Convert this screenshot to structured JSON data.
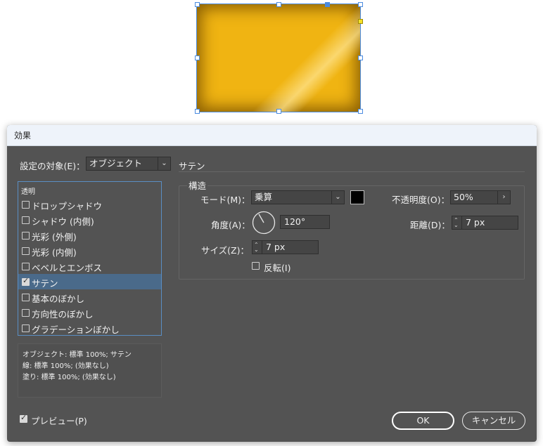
{
  "dialog": {
    "title": "効果",
    "settings_target_label": "設定の対象(E)：",
    "settings_target_value": "オブジェクト",
    "section_title": "サテン",
    "list_header": "透明",
    "effects": [
      {
        "label": "ドロップシャドウ",
        "checked": false,
        "active": false
      },
      {
        "label": "シャドウ (内側)",
        "checked": false,
        "active": false
      },
      {
        "label": "光彩 (外側)",
        "checked": false,
        "active": false
      },
      {
        "label": "光彩 (内側)",
        "checked": false,
        "active": false
      },
      {
        "label": "ベベルとエンボス",
        "checked": false,
        "active": false
      },
      {
        "label": "サテン",
        "checked": true,
        "active": true
      },
      {
        "label": "基本のぼかし",
        "checked": false,
        "active": false
      },
      {
        "label": "方向性のぼかし",
        "checked": false,
        "active": false
      },
      {
        "label": "グラデーションぼかし",
        "checked": false,
        "active": false
      }
    ],
    "summary": [
      "オブジェクト: 標準 100%; サテン",
      "線: 標準 100%; (効果なし)",
      "塗り: 標準 100%; (効果なし)"
    ],
    "structure": {
      "title": "構造",
      "mode_label": "モード(M)：",
      "mode_value": "乗算",
      "mode_color": "#000000",
      "opacity_label": "不透明度(O)：",
      "opacity_value": "50%",
      "angle_label": "角度(A)：",
      "angle_value": "120°",
      "angle_degrees": 120,
      "distance_label": "距離(D)：",
      "distance_value": "7 px",
      "size_label": "サイズ(Z)：",
      "size_value": "7 px",
      "invert_label": "反転(I)",
      "invert_checked": false
    },
    "preview_label": "プレビュー(P)",
    "preview_checked": true,
    "ok_label": "OK",
    "cancel_label": "キャンセル"
  },
  "canvas": {
    "object_color": "#f0b412",
    "selection_color": "#4a8be0"
  }
}
